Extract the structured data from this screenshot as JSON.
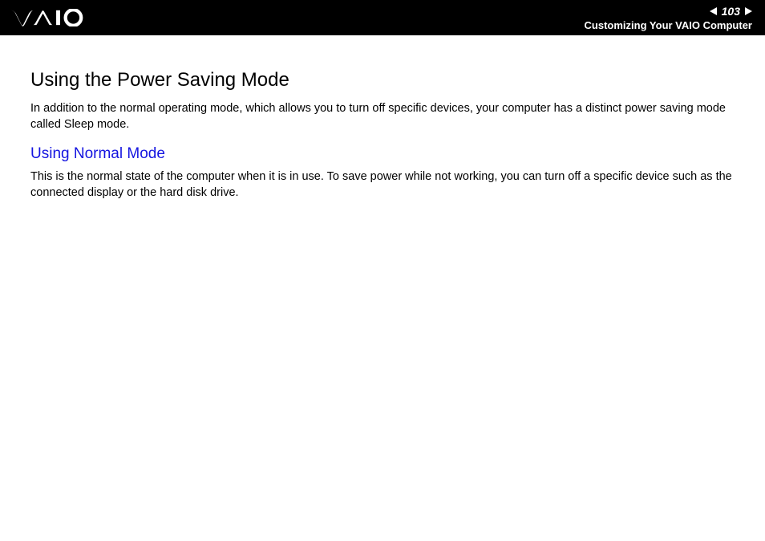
{
  "header": {
    "page_number": "103",
    "section_name": "Customizing Your VAIO Computer"
  },
  "content": {
    "main_heading": "Using the Power Saving Mode",
    "intro_text": "In addition to the normal operating mode, which allows you to turn off specific devices, your computer has a distinct power saving mode called Sleep mode.",
    "sub_heading": "Using Normal Mode",
    "body_text": "This is the normal state of the computer when it is in use. To save power while not working, you can turn off a specific device such as the connected display or the hard disk drive."
  }
}
